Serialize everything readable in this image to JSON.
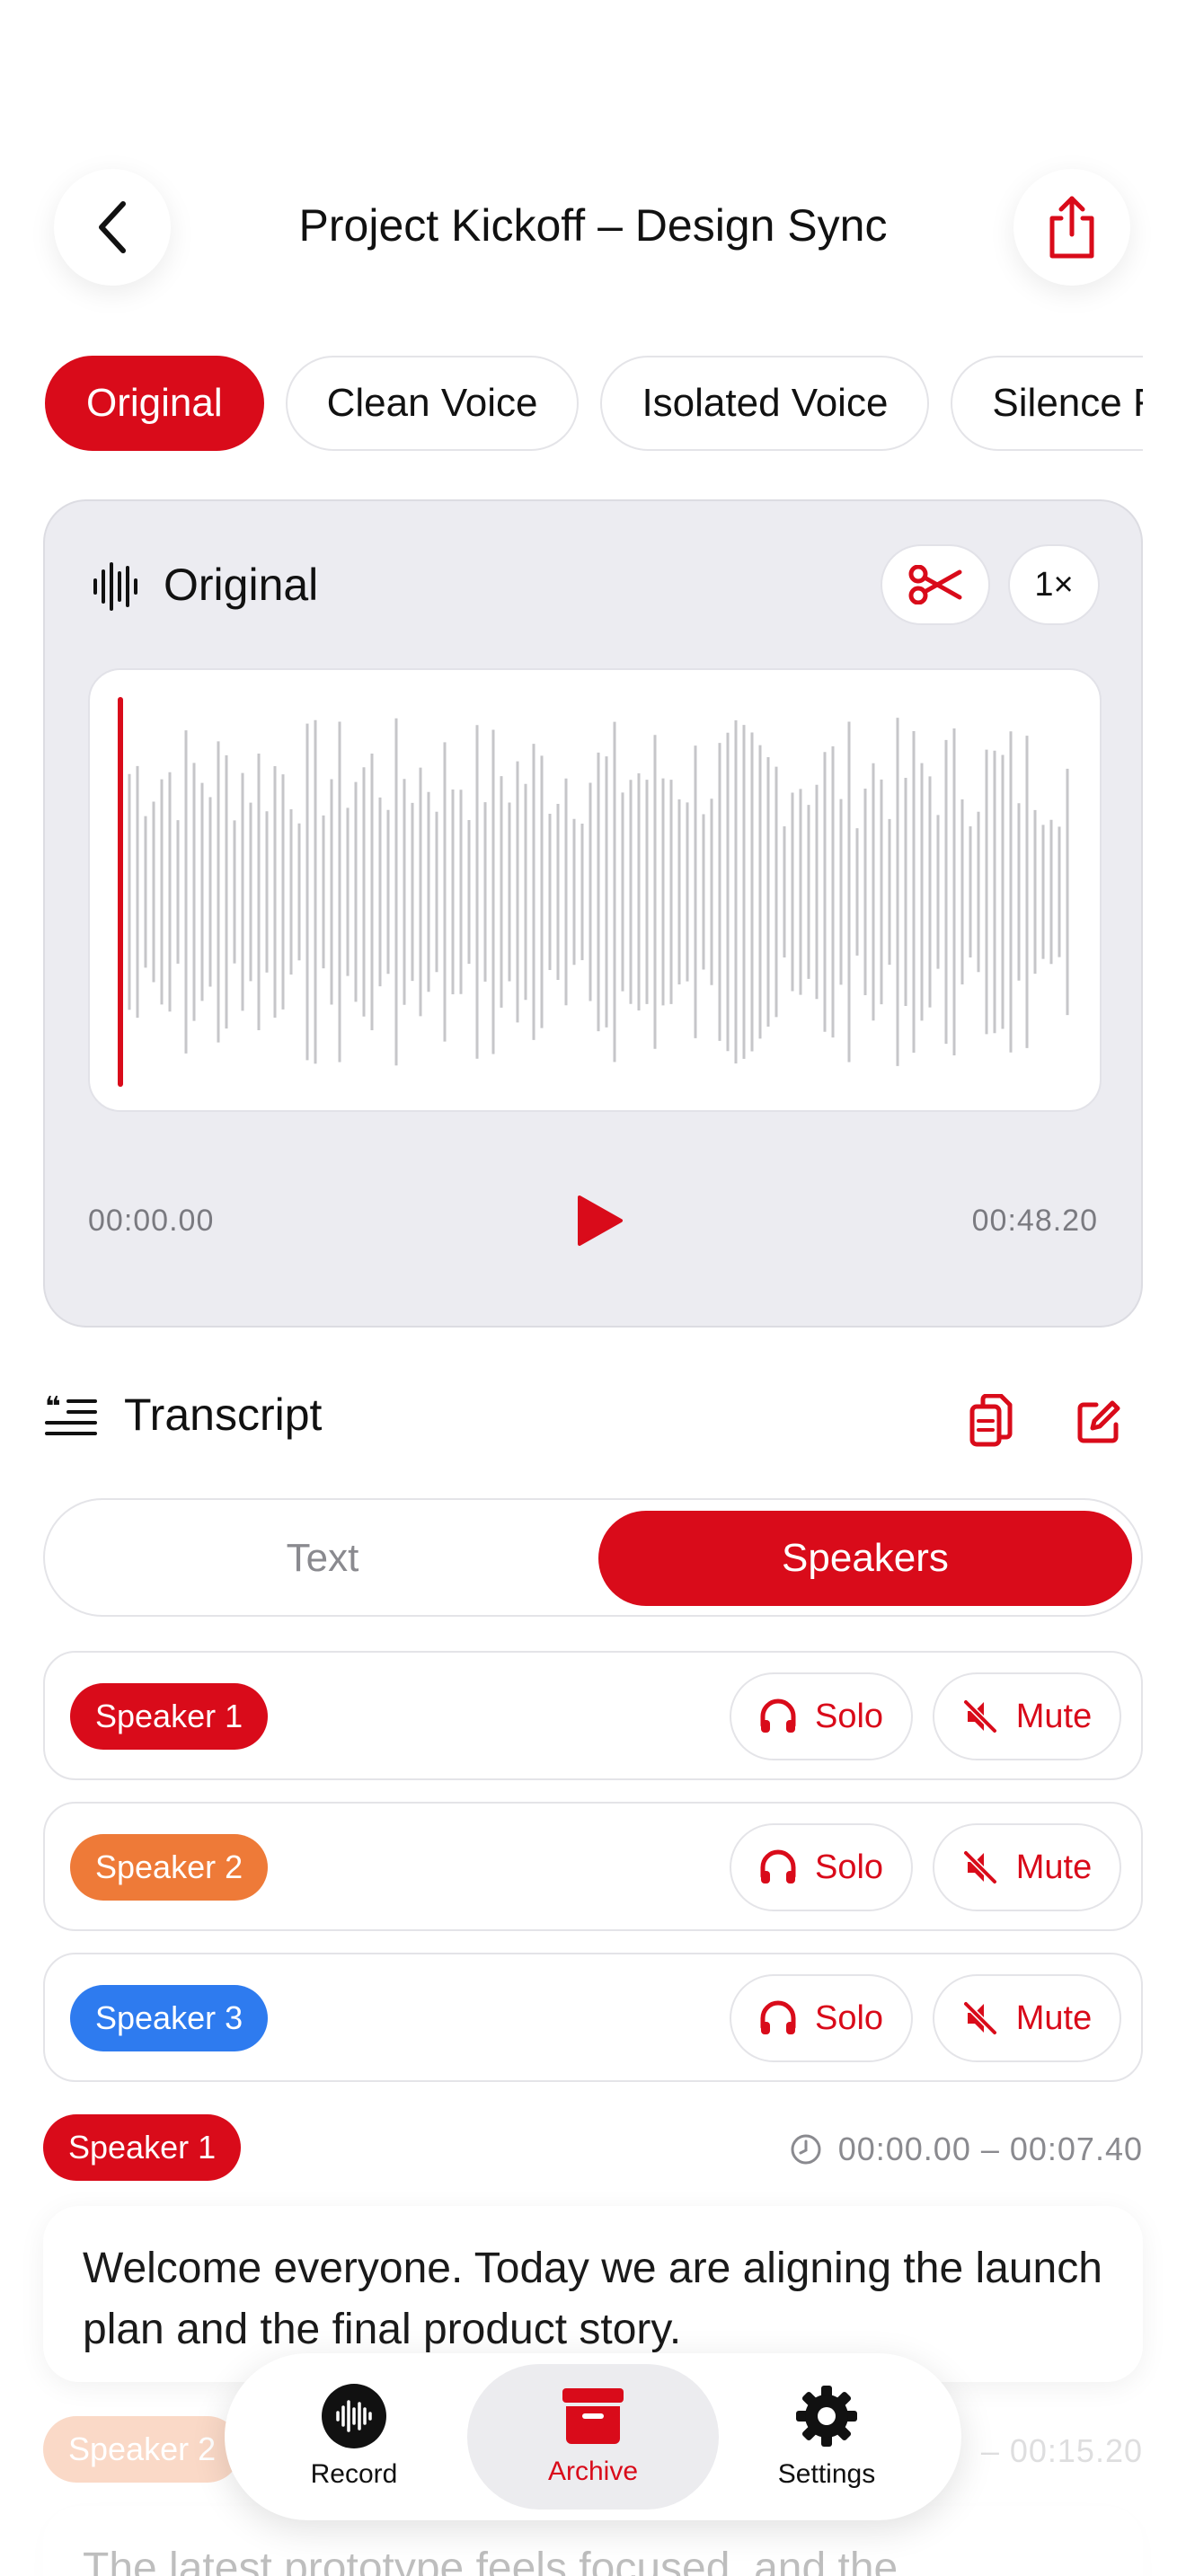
{
  "header": {
    "title": "Project Kickoff – Design Sync",
    "back_icon": "chevron-left-icon",
    "share_icon": "share-icon"
  },
  "tabs": [
    {
      "label": "Original",
      "active": true
    },
    {
      "label": "Clean Voice",
      "active": false
    },
    {
      "label": "Isolated Voice",
      "active": false
    },
    {
      "label": "Silence Removed",
      "active": false
    }
  ],
  "player": {
    "title": "Original",
    "speed": "1×",
    "time_start": "00:00.00",
    "time_end": "00:48.20",
    "progress": 0.0
  },
  "transcript": {
    "title": "Transcript",
    "view_text": "Text",
    "view_speakers": "Speakers",
    "active_view": "Speakers"
  },
  "speakers": [
    {
      "name": "Speaker 1",
      "color": "#d90b1a",
      "solo": "Solo",
      "mute": "Mute"
    },
    {
      "name": "Speaker 2",
      "color": "#ee7a38",
      "solo": "Solo",
      "mute": "Mute"
    },
    {
      "name": "Speaker 3",
      "color": "#2e7bef",
      "solo": "Solo",
      "mute": "Mute"
    }
  ],
  "segments": [
    {
      "speaker": "Speaker 1",
      "time": "00:00.00 – 00:07.40",
      "text": "Welcome everyone. Today we are aligning the launch plan and the final product story."
    },
    {
      "speaker": "Speaker 2",
      "time": "– 00:15.20",
      "text": "The latest prototype feels focused, and the"
    }
  ],
  "nav": {
    "record": "Record",
    "archive": "Archive",
    "settings": "Settings",
    "active": "Archive"
  },
  "colors": {
    "accent": "#d90b1a",
    "card_bg": "#ececf1",
    "waveform": "#c6c6c9"
  }
}
